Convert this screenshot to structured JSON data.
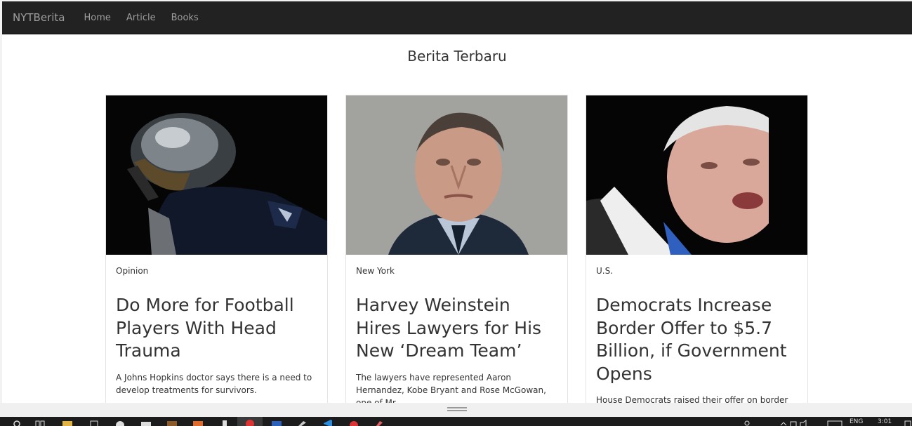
{
  "navbar": {
    "brand": "NYTBerita",
    "links": [
      "Home",
      "Article",
      "Books"
    ]
  },
  "page_heading": "Berita Terbaru",
  "cards": [
    {
      "section": "Opinion",
      "headline": "Do More for Football Players With Head Trauma",
      "abstract": "A Johns Hopkins doctor says there is a need to develop treatments for survivors."
    },
    {
      "section": "New York",
      "headline": "Harvey Weinstein Hires Lawyers for His New ‘Dream Team’",
      "abstract": "The lawyers have represented Aaron Hernandez, Kobe Bryant and Rose McGowan, one of Mr."
    },
    {
      "section": "U.S.",
      "headline": "Democrats Increase Border Offer to $5.7 Billion, if Government Opens",
      "abstract": "House Democrats raised their offer on border"
    }
  ],
  "taskbar": {
    "language": "ENG",
    "time": "3:01"
  },
  "colors": {
    "navbar_bg": "#222222",
    "nav_text": "#9d9d9d",
    "taskbar_bg": "#1c1c1c"
  }
}
